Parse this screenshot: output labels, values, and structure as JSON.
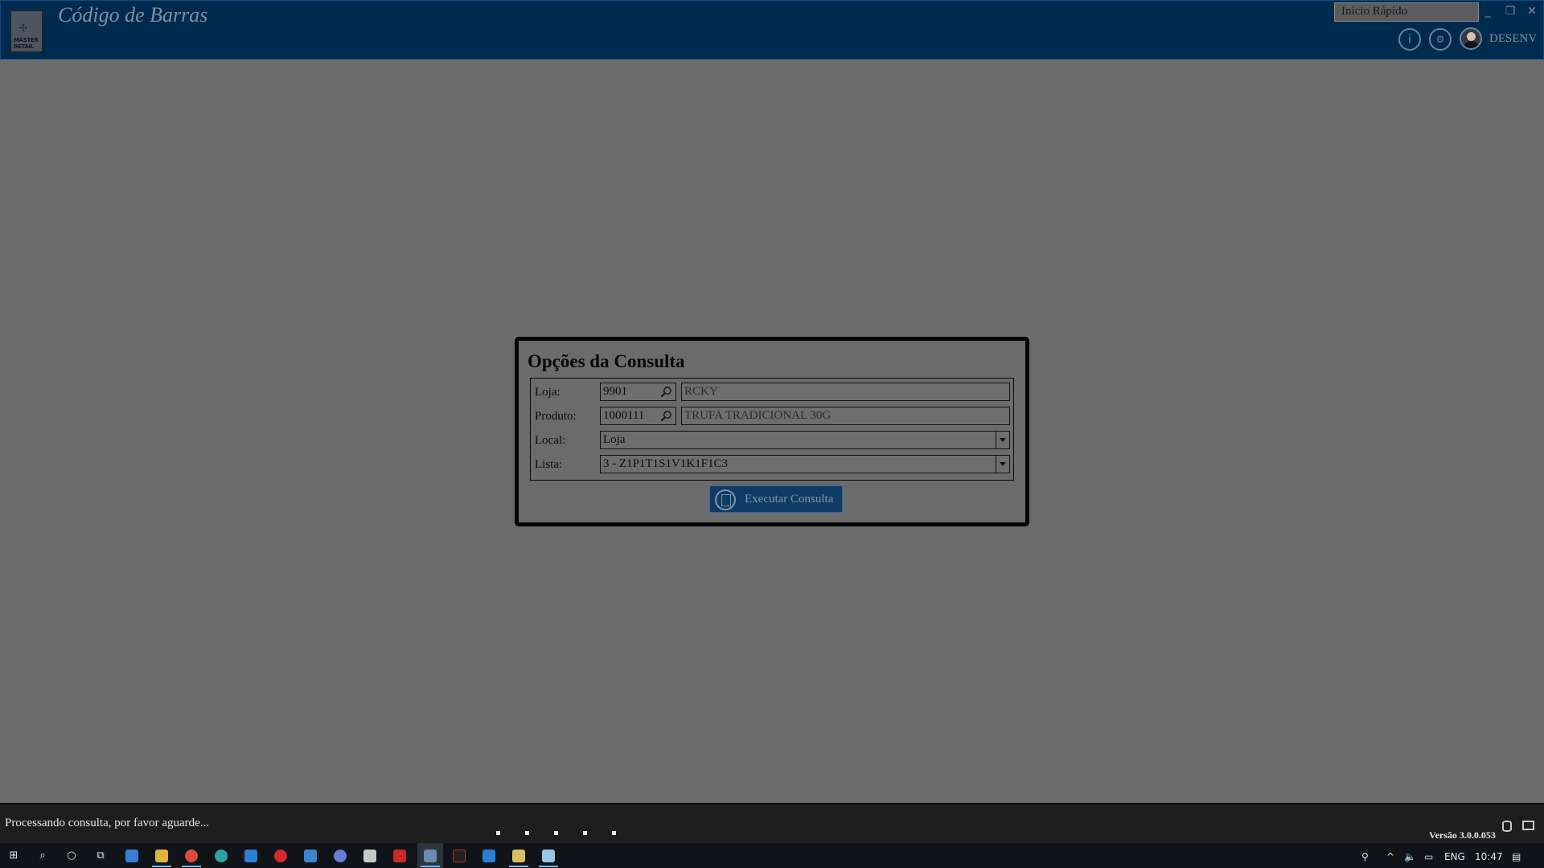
{
  "window": {
    "title": "Código de Barras",
    "logo_text": "MASTER RETAIL",
    "quick_start_value": "Início Rápido",
    "user_name": "DESENV"
  },
  "dialog": {
    "title": "Opções da Consulta",
    "rows": {
      "loja": {
        "label": "Loja:",
        "code": "9901",
        "description": "RCKY"
      },
      "produto": {
        "label": "Produto:",
        "code": "1000111",
        "description": "TRUFA TRADICIONAL 30G"
      },
      "local": {
        "label": "Local:",
        "selected": "Loja"
      },
      "lista": {
        "label": "Lista:",
        "selected": "3 - Z1P1T1S1V1K1F1C3"
      }
    },
    "run_button_label": "Executar Consulta"
  },
  "statusbar": {
    "message": "Processando consulta, por favor aguarde...",
    "version": "Versão 3.0.0.053"
  },
  "taskbar": {
    "language": "ENG",
    "time": "10:47"
  },
  "colors": {
    "title_bar_bg": "#002b4e",
    "workspace_bg": "#6b6b6b",
    "status_bar_bg": "#1e1e1e",
    "button_bg": "#0f3a64"
  }
}
